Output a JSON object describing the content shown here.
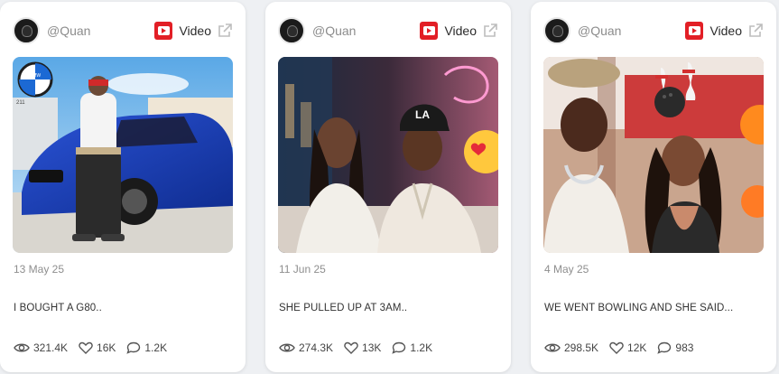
{
  "cards": [
    {
      "handle": "@Quan",
      "platform_label": "Video",
      "platform_icon": "youtube-icon",
      "date": "13 May 25",
      "title": "I BOUGHT A G80..",
      "views": "321.4K",
      "likes": "16K",
      "comments": "1.2K"
    },
    {
      "handle": "@Quan",
      "platform_label": "Video",
      "platform_icon": "youtube-icon",
      "date": "11 Jun 25",
      "title": "SHE PULLED UP AT 3AM..",
      "views": "274.3K",
      "likes": "13K",
      "comments": "1.2K"
    },
    {
      "handle": "@Quan",
      "platform_label": "Video",
      "platform_icon": "youtube-icon",
      "date": "4 May 25",
      "title": "WE WENT BOWLING AND SHE SAID...",
      "views": "298.5K",
      "likes": "12K",
      "comments": "983"
    }
  ],
  "thumb_1_overlay": {
    "bmw_sign": "BMW",
    "lot_text": "211"
  },
  "thumb_2_overlay": {
    "cap_logo": "LA"
  },
  "colors": {
    "youtube_red": "#e21f26",
    "muted_text": "#8c8c8c",
    "card_bg": "#ffffff",
    "page_bg": "#eef0f3"
  }
}
